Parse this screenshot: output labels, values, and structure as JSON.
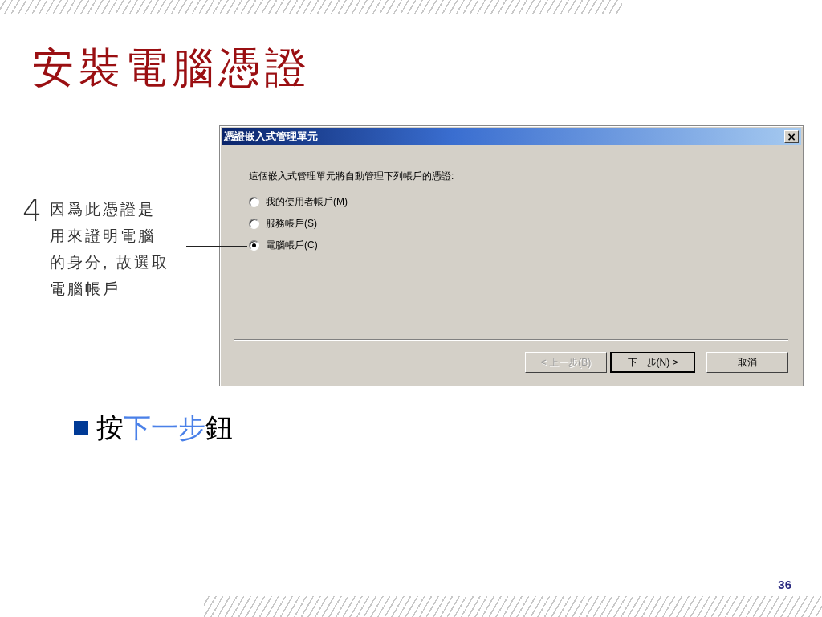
{
  "slide": {
    "title": "安裝電腦憑證",
    "page_number": "36"
  },
  "callout": {
    "step": "4",
    "lines": [
      "因爲此憑證是",
      "用來證明電腦",
      "的身分, 故選取",
      "電腦帳戶"
    ]
  },
  "dialog": {
    "title": "憑證嵌入式管理單元",
    "close": "×",
    "prompt": "這個嵌入式管理單元將自動管理下列帳戶的憑證:",
    "options": [
      {
        "label": "我的使用者帳戶(M)",
        "selected": false
      },
      {
        "label": "服務帳戶(S)",
        "selected": false
      },
      {
        "label": "電腦帳戶(C)",
        "selected": true
      }
    ],
    "buttons": [
      {
        "label": "< 上一步(B)",
        "disabled": true,
        "default": false
      },
      {
        "label": "下一步(N) >",
        "disabled": false,
        "default": true
      },
      {
        "label": "取消",
        "disabled": false,
        "default": false
      }
    ]
  },
  "bullet": {
    "parts": [
      {
        "text": "按",
        "highlight": false
      },
      {
        "text": "下一步",
        "highlight": true
      },
      {
        "text": "鈕",
        "highlight": false
      }
    ]
  }
}
